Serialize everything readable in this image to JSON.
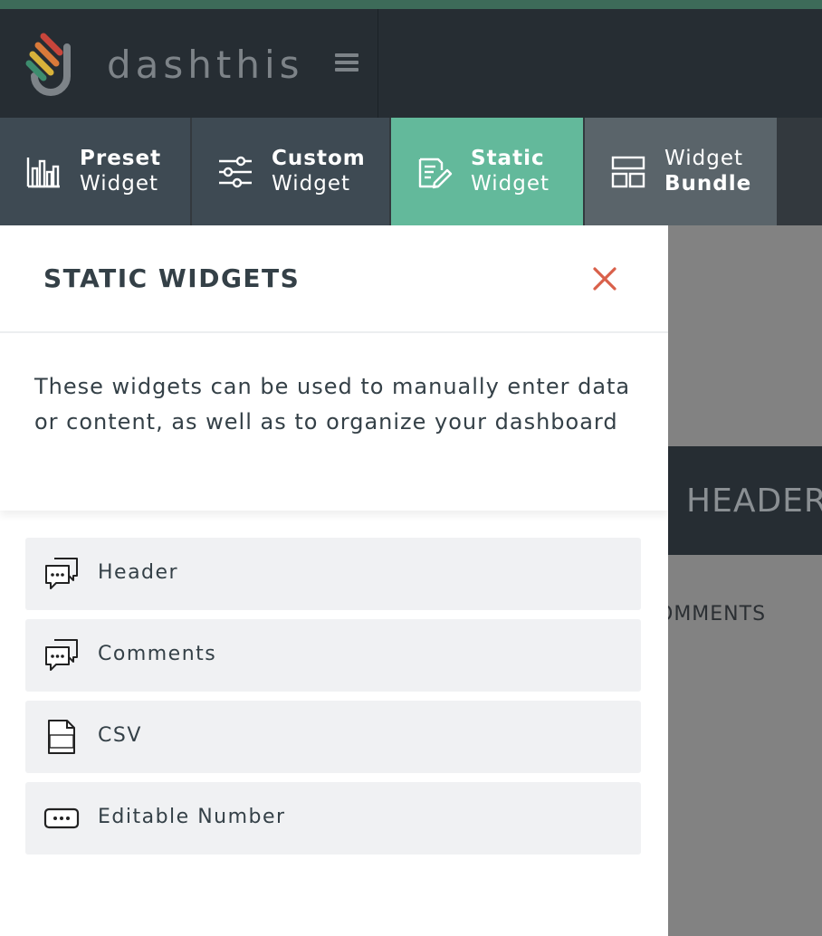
{
  "brand": {
    "name": "dashthis"
  },
  "tabs": [
    {
      "line1": "Preset",
      "line2": "Widget",
      "icon": "bar-chart-icon"
    },
    {
      "line1": "Custom",
      "line2": "Widget",
      "icon": "sliders-icon"
    },
    {
      "line1": "Static",
      "line2": "Widget",
      "icon": "edit-document-icon",
      "active": true
    },
    {
      "line1": "Widget",
      "line2": "Bundle",
      "icon": "layout-icon"
    }
  ],
  "panel": {
    "title": "STATIC WIDGETS",
    "description": "These widgets can be used to manually enter data or content, as well as to organize your dashboard",
    "items": [
      {
        "label": "Header",
        "icon": "chat-bubbles-icon"
      },
      {
        "label": "Comments",
        "icon": "chat-bubbles-icon"
      },
      {
        "label": "CSV",
        "icon": "csv-file-icon"
      },
      {
        "label": "Editable Number",
        "icon": "number-box-icon"
      }
    ]
  },
  "background": {
    "header_text": "HEADER",
    "comments_text": "OMMENTS"
  },
  "colors": {
    "accent": "#63b99b",
    "close": "#d9604a",
    "topbar": "#262d33",
    "tab": "#3e4a53"
  }
}
